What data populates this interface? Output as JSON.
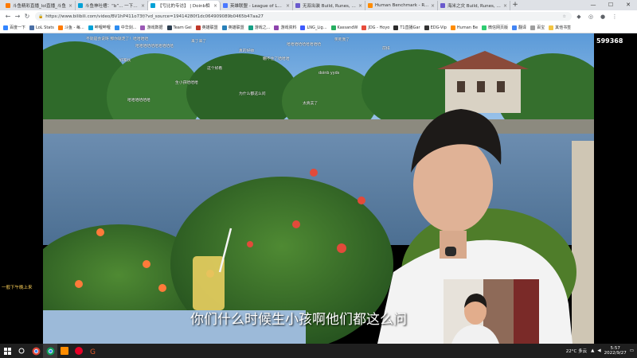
{
  "browser": {
    "tabs": [
      {
        "label": "斗鱼精彩直播_lol直播_斗鱼",
        "color": "#ff7a00",
        "active": false
      },
      {
        "label": "斗鱼神吐槽：“b”... 一下小 ...",
        "color": "#00a1d6",
        "active": false
      },
      {
        "label": "【亏比的专访】 | Doinb相",
        "color": "#00a1d6",
        "active": true
      },
      {
        "label": "英雄联盟 - League of Legends",
        "color": "#4a78ff",
        "active": false
      },
      {
        "label": "无双出装 Build, Runes, Co...",
        "color": "#6a5acd",
        "active": false
      },
      {
        "label": "Human Benchmark - React",
        "color": "#ff8c00",
        "active": false
      },
      {
        "label": "海米之灾 Build, Runes, Co...",
        "color": "#6a5acd",
        "active": false
      }
    ],
    "new_tab_symbol": "+",
    "window_controls": [
      "—",
      "☐",
      "✕"
    ],
    "url": "https://www.bilibili.com/video/BV1hP411o73f/?vd_source=19414280f1dc064909089b0465b47aa27",
    "bookmarks": [
      {
        "label": "百度一下",
        "color": "#3385ff"
      },
      {
        "label": "LoL Stats",
        "color": "#4a6fa5"
      },
      {
        "label": "斗鱼 - 每...",
        "color": "#ff7a00"
      },
      {
        "label": "哔哩哔哩",
        "color": "#00a1d6"
      },
      {
        "label": "中华剑...",
        "color": "#2d8cf0"
      },
      {
        "label": "游戏数据",
        "color": "#9b59b6"
      },
      {
        "label": "Team Gei",
        "color": "#2c3e50"
      },
      {
        "label": "英雄联盟",
        "color": "#c0392b"
      },
      {
        "label": "英雄联盟",
        "color": "#2980b9"
      },
      {
        "label": "游戏之...",
        "color": "#16a085"
      },
      {
        "label": "游戏资料",
        "color": "#8e44ad"
      },
      {
        "label": "LNG_Lig...",
        "color": "#3d5afe"
      },
      {
        "label": "KassandW",
        "color": "#27ae60"
      },
      {
        "label": "JDG - Hoyo",
        "color": "#e74c3c"
      },
      {
        "label": "T1直播Gar",
        "color": "#2c2c2c"
      },
      {
        "label": "EDG-Vip",
        "color": "#333333"
      },
      {
        "label": "Human Be",
        "color": "#ff8c00"
      },
      {
        "label": "微信网页版",
        "color": "#2ecc71"
      },
      {
        "label": "翻译",
        "color": "#4285f4"
      },
      {
        "label": "百宝",
        "color": "#9e9e9e"
      },
      {
        "label": "其他书签",
        "color": "#f4c542"
      }
    ]
  },
  "video": {
    "subtitle": "你们什么时候生小孩啊他们都这么问",
    "viewer_count": "599368",
    "left_danmaku": "一般下午晚上来",
    "danmaku": [
      "不就是会说呀 那你就走了！哈哈哈哈",
      "哈哈哈哈哈哈哈哈哈哈",
      "来了来了",
      "真的好帅",
      "哈哈哈哈哈哈哈哈哈",
      "笑死我了",
      "前排",
      "好家伙",
      "这个好看",
      "绷不住了哈哈哈",
      "doinb yyds",
      "生小孩哈哈哈",
      "为什么都这么问",
      "哈哈哈哈哈哈",
      "太真实了"
    ]
  },
  "taskbar": {
    "weather": "22°C 多云",
    "time": "5:57",
    "date": "2022/9/27"
  }
}
